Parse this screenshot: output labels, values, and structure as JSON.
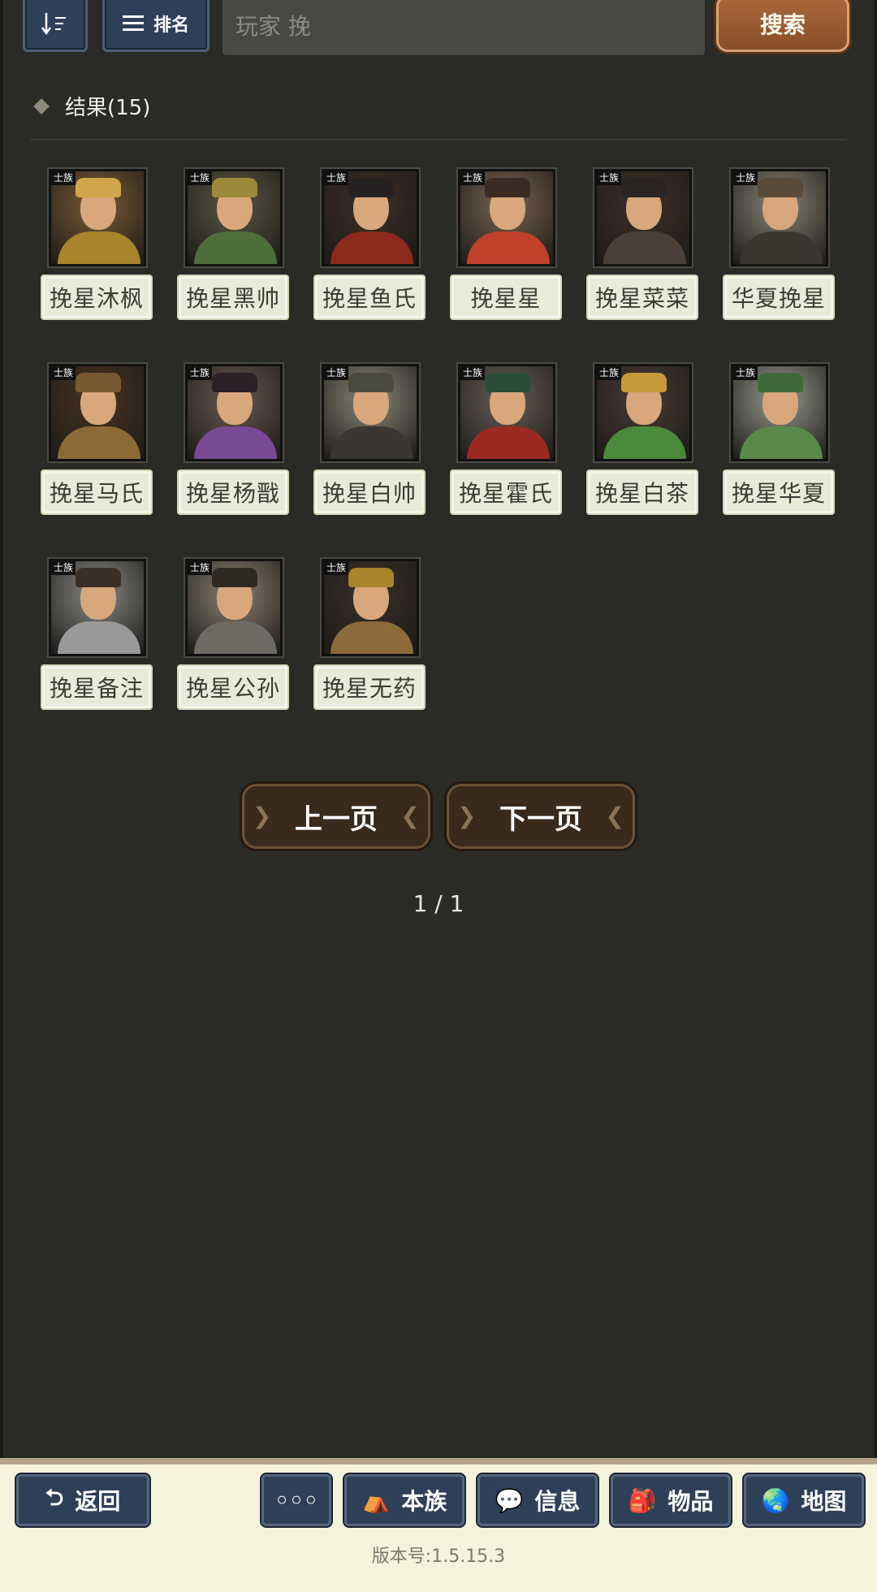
{
  "topbar": {
    "sort_icon": "sort-icon",
    "rank_label": "排名",
    "search_value": "玩家 挽",
    "search_button": "搜索"
  },
  "results": {
    "title": "结果(15)",
    "tag_label": "士族",
    "items": [
      {
        "name": "挽星沐枫",
        "palette": [
          "#7c5c36",
          "#d0a64a",
          "#a8842a"
        ]
      },
      {
        "name": "挽星黑帅",
        "palette": [
          "#5c5844",
          "#9c8a3a",
          "#4e6e3a"
        ]
      },
      {
        "name": "挽星鱼氏",
        "palette": [
          "#3e2e26",
          "#262222",
          "#8c2a1e"
        ]
      },
      {
        "name": "挽星星",
        "palette": [
          "#7a6450",
          "#3a2a22",
          "#c0402a"
        ]
      },
      {
        "name": "挽星菜菜",
        "palette": [
          "#3e3026",
          "#2a2422",
          "#4a4038"
        ]
      },
      {
        "name": "华夏挽星",
        "palette": [
          "#8a8576",
          "#5a4a3a",
          "#3a3630"
        ]
      },
      {
        "name": "挽星马氏",
        "palette": [
          "#4a3422",
          "#7a5a32",
          "#8c6a36"
        ]
      },
      {
        "name": "挽星杨戬",
        "palette": [
          "#6a5a50",
          "#2a2226",
          "#7a4a96"
        ]
      },
      {
        "name": "挽星白帅",
        "palette": [
          "#8c887a",
          "#4a4a3c",
          "#3a3634"
        ]
      },
      {
        "name": "挽星霍氏",
        "palette": [
          "#6a6058",
          "#2a4e3a",
          "#9a2a22"
        ]
      },
      {
        "name": "挽星白茶",
        "palette": [
          "#4a3a34",
          "#c49a3a",
          "#4a8a3a"
        ]
      },
      {
        "name": "挽星华夏",
        "palette": [
          "#9a9a90",
          "#3e6a3a",
          "#5a8a4a"
        ]
      },
      {
        "name": "挽星备注",
        "palette": [
          "#8a8a86",
          "#3a2e26",
          "#9a9a9a"
        ]
      },
      {
        "name": "挽星公孙",
        "palette": [
          "#8c8272",
          "#2e2822",
          "#6e6a64"
        ]
      },
      {
        "name": "挽星无药",
        "palette": [
          "#3a3028",
          "#a8842a",
          "#8c6a3a"
        ]
      }
    ]
  },
  "pager": {
    "prev_label": "上一页",
    "next_label": "下一页",
    "indicator": "1 / 1"
  },
  "bottom_nav": {
    "back_label": "返回",
    "more_label": "◦◦◦",
    "clan_label": "本族",
    "info_label": "信息",
    "items_label": "物品",
    "map_label": "地图"
  },
  "version": "版本号:1.5.15.3"
}
